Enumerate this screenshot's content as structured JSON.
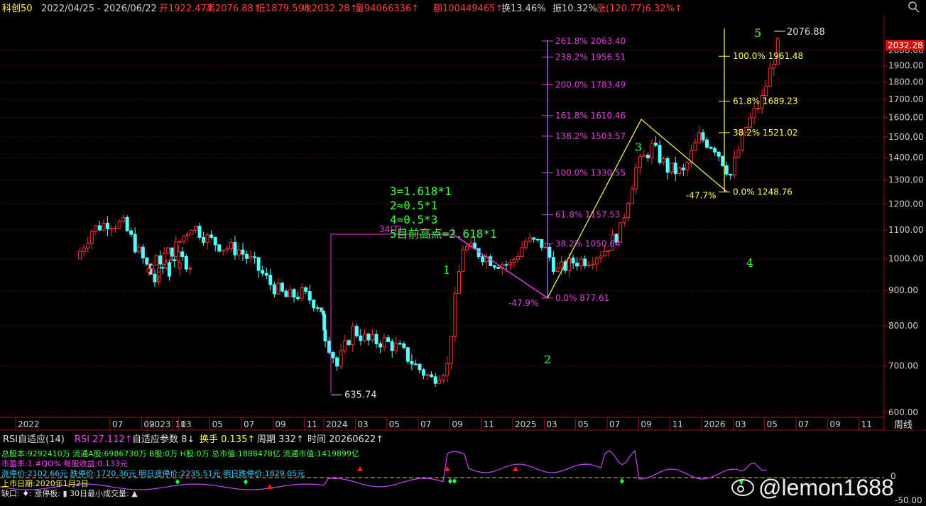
{
  "header": {
    "name": "科创50",
    "range": "2022/04/25 - 2026/06/22",
    "open": "开1922.47↑",
    "high": "高2076.88↑",
    "low": "低1879.59↑",
    "close": "收2032.28↑",
    "volume": "量94066336↑",
    "amount": "额100449465↑",
    "turnover": "换13.46%",
    "amplitude": "振10.32%",
    "change": "涨(120.77)6.32%↑"
  },
  "price_axis": {
    "ticks": [
      "2000.00",
      "1900.00",
      "1800.00",
      "1700.00",
      "1600.00",
      "1500.00",
      "1400.00",
      "1300.00",
      "1200.00",
      "1100.00",
      "1000.00",
      "900.00",
      "800.00",
      "700.00",
      "600.00"
    ],
    "current_price_label": "2032.28"
  },
  "time_axis": {
    "labels": [
      "2022",
      "07",
      "09",
      "11",
      "2023",
      "03",
      "05",
      "07",
      "09",
      "11",
      "2024",
      "03",
      "05",
      "07",
      "09",
      "11",
      "2025",
      "03",
      "05",
      "07",
      "09",
      "11",
      "2026",
      "03",
      "05",
      "07",
      "09",
      "11"
    ],
    "period_button": "周线"
  },
  "annotations": {
    "low_2024": "635.74",
    "cycle_label": "34(T)",
    "high_label": "2076.88",
    "wave_labels": [
      "1",
      "2",
      "3",
      "4",
      "5"
    ],
    "notes": [
      "3=1.618*1",
      "2≈0.5*1",
      "4≈0.5*3",
      "5目前高点=2.618*1"
    ],
    "fib_magenta": [
      {
        "label": "261.8% 2063.40",
        "value": 2063.4
      },
      {
        "label": "238.2% 1956.51",
        "value": 1956.51
      },
      {
        "label": "200.0% 1783.49",
        "value": 1783.49
      },
      {
        "label": "161.8% 1610.46",
        "value": 1610.46
      },
      {
        "label": "138.2% 1503.57",
        "value": 1503.57
      },
      {
        "label": "100.0% 1330.55",
        "value": 1330.55
      },
      {
        "label": "61.8% 1157.53",
        "value": 1157.53
      },
      {
        "label": "38.2% 1050.64",
        "value": 1050.64
      },
      {
        "label": "0.0% 877.61",
        "value": 877.61
      }
    ],
    "fib_magenta_neg": "-47.9%",
    "fib_yellow": [
      {
        "label": "100.0% 1961.48",
        "value": 1961.48
      },
      {
        "label": "61.8% 1689.23",
        "value": 1689.23
      },
      {
        "label": "38.2% 1521.02",
        "value": 1521.02
      },
      {
        "label": "0.0% 1248.76",
        "value": 1248.76
      }
    ],
    "fib_yellow_neg": "-47.7%"
  },
  "indicator": {
    "title": "RSI自适应(14)",
    "rsi": "RSI 27.112↑",
    "param": "自适应参数 8↓",
    "turnover": "换手 0.135↑",
    "cycle": "周期 332↑",
    "time": "时间 20260622↑",
    "info_lines": [
      "总股本:9292410万  流通A股:6986730万  B股:0万  H股:0万  总市值:1888478亿  流通市值:1419899亿",
      "市盈率:1.#QO%  每股收益:0.133元",
      "涨停价:2102.66元  跌停价:1720.36元  明日涨停价:2235.51元  明日跌停价:1829.05元",
      "上市日期:2020年1月2日",
      "缺口: ♦: 涨停板: ▮ 30日最小成交量: ▲"
    ],
    "axis_ticks": [
      "0",
      "-50.00"
    ]
  },
  "watermark": "@lemon1688",
  "colors": {
    "up": "#ff3232",
    "down": "#54ffff",
    "axis": "#a01010",
    "fib_magenta": "#e040e0",
    "fib_yellow": "#ffff60",
    "wave": "#40ff40"
  },
  "chart_data": {
    "type": "candlestick",
    "title": "科创50",
    "x_range": [
      "2022/04/25",
      "2026/06/22"
    ],
    "ylim": [
      600,
      2100
    ],
    "y_scale": "log",
    "key_points": [
      {
        "label": "low",
        "date": "2024/09",
        "value": 635.74
      },
      {
        "label": "wave 1 top",
        "date": "2024/10",
        "value": 1110
      },
      {
        "label": "wave 2 low",
        "date": "2025/04",
        "value": 877.61
      },
      {
        "label": "wave 3 top",
        "date": "2025/10",
        "value": 1590
      },
      {
        "label": "wave 4 low",
        "date": "2026/03",
        "value": 1248.76
      },
      {
        "label": "wave 5 high",
        "date": "2026/06",
        "value": 2076.88
      }
    ],
    "weekly_close": [
      {
        "d": "2022/05",
        "c": 1000
      },
      {
        "d": "2022/06",
        "c": 1100
      },
      {
        "d": "2022/07",
        "c": 1130
      },
      {
        "d": "2022/08",
        "c": 1120
      },
      {
        "d": "2022/09",
        "c": 1020
      },
      {
        "d": "2022/10",
        "c": 930
      },
      {
        "d": "2022/11",
        "c": 1010
      },
      {
        "d": "2022/12",
        "c": 990
      },
      {
        "d": "2023/01",
        "c": 960
      },
      {
        "d": "2023/02",
        "c": 1000
      },
      {
        "d": "2023/03",
        "c": 1040
      },
      {
        "d": "2023/04",
        "c": 1120
      },
      {
        "d": "2023/05",
        "c": 1070
      },
      {
        "d": "2023/06",
        "c": 1040
      },
      {
        "d": "2023/07",
        "c": 1030
      },
      {
        "d": "2023/08",
        "c": 980
      },
      {
        "d": "2023/09",
        "c": 920
      },
      {
        "d": "2023/10",
        "c": 880
      },
      {
        "d": "2023/11",
        "c": 890
      },
      {
        "d": "2023/12",
        "c": 860
      },
      {
        "d": "2024/01",
        "c": 800
      },
      {
        "d": "2024/02",
        "c": 700
      },
      {
        "d": "2024/03",
        "c": 790
      },
      {
        "d": "2024/04",
        "c": 760
      },
      {
        "d": "2024/05",
        "c": 760
      },
      {
        "d": "2024/06",
        "c": 740
      },
      {
        "d": "2024/07",
        "c": 700
      },
      {
        "d": "2024/08",
        "c": 670
      },
      {
        "d": "2024/09",
        "c": 700
      },
      {
        "d": "2024/10",
        "c": 1040
      },
      {
        "d": "2024/11",
        "c": 1020
      },
      {
        "d": "2024/12",
        "c": 990
      },
      {
        "d": "2025/01",
        "c": 980
      },
      {
        "d": "2025/02",
        "c": 1060
      },
      {
        "d": "2025/03",
        "c": 1050
      },
      {
        "d": "2025/04",
        "c": 960
      },
      {
        "d": "2025/05",
        "c": 990
      },
      {
        "d": "2025/06",
        "c": 1000
      },
      {
        "d": "2025/07",
        "c": 1030
      },
      {
        "d": "2025/08",
        "c": 1100
      },
      {
        "d": "2025/09",
        "c": 1350
      },
      {
        "d": "2025/10",
        "c": 1450
      },
      {
        "d": "2025/11",
        "c": 1350
      },
      {
        "d": "2025/12",
        "c": 1330
      },
      {
        "d": "2026/01",
        "c": 1500
      },
      {
        "d": "2026/02",
        "c": 1450
      },
      {
        "d": "2026/03",
        "c": 1320
      },
      {
        "d": "2026/04",
        "c": 1550
      },
      {
        "d": "2026/05",
        "c": 1700
      },
      {
        "d": "2026/06",
        "c": 2032.28
      }
    ]
  }
}
